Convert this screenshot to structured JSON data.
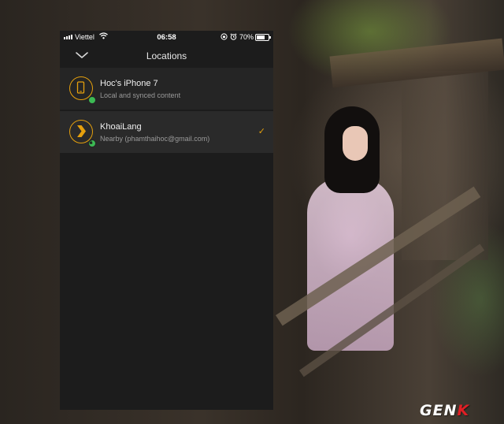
{
  "status_bar": {
    "carrier": "Viettel",
    "time": "06:58",
    "battery_percent": "70%"
  },
  "nav": {
    "title": "Locations"
  },
  "locations": [
    {
      "title": "Hoc's iPhone 7",
      "subtitle": "Local and synced content",
      "icon": "phone-icon",
      "status": "online",
      "selected": false
    },
    {
      "title": "KhoaiLang",
      "subtitle": "Nearby (phamthaihoc@gmail.com)",
      "icon": "plex-chevron-icon",
      "status": "online-locked",
      "selected": true
    }
  ],
  "colors": {
    "accent": "#e5a00d",
    "online": "#3cba54",
    "panel": "#1c1c1c",
    "row": "#252525"
  },
  "watermark": {
    "prefix": "GEN",
    "suffix": "K"
  }
}
